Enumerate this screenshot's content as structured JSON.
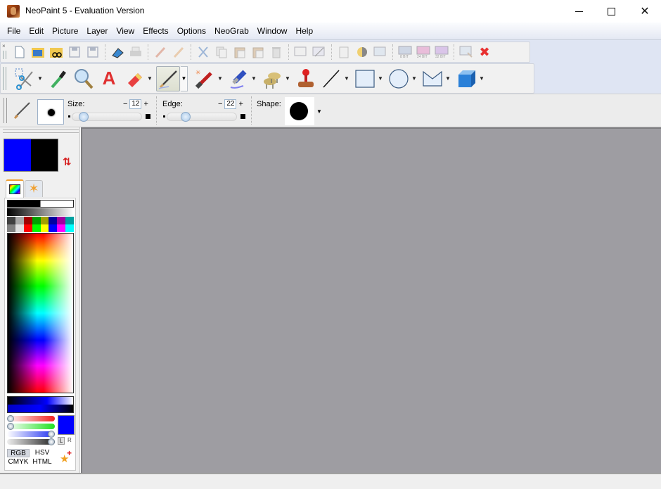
{
  "window": {
    "title": "NeoPaint 5 - Evaluation Version",
    "minimize": "minimize",
    "maximize": "maximize",
    "close": "✕"
  },
  "menu": [
    "File",
    "Edit",
    "Picture",
    "Layer",
    "View",
    "Effects",
    "Options",
    "NeoGrab",
    "Window",
    "Help"
  ],
  "main_toolbar": {
    "icons": [
      "new-icon",
      "open-icon",
      "browse-icon",
      "save-icon",
      "save-as-icon",
      "scan-icon",
      "print-icon",
      "undo-brush-icon",
      "redo-brush-icon",
      "cut-icon",
      "copy-icon",
      "paste-icon",
      "paste-special-icon",
      "delete-icon",
      "select-screen-icon",
      "capture-icon",
      "clipboard-icon",
      "contrast-icon",
      "resize-icon",
      "8bit-icon",
      "24bit-icon",
      "32bit-icon",
      "zoom-window-icon",
      "close-red-icon"
    ]
  },
  "tools_toolbar": {
    "tools": [
      "selection-scissors",
      "eyedropper",
      "magnifier",
      "text",
      "eraser",
      "brush",
      "paint-brush",
      "airbrush",
      "clone-sheep",
      "stamp",
      "line",
      "rectangle",
      "ellipse",
      "polygon",
      "3d-cube"
    ],
    "selected": "brush"
  },
  "options_bar": {
    "size_label": "Size:",
    "size_value": "12",
    "size_fraction": 0.1,
    "edge_label": "Edge:",
    "edge_value": "22",
    "edge_fraction": 0.22,
    "shape_label": "Shape:",
    "minus": "−",
    "plus": "+"
  },
  "colors": {
    "foreground": "#0000ff",
    "background": "#000000",
    "swatches": [
      "#404040",
      "#a8a8a8",
      "#a00000",
      "#00a000",
      "#a0a000",
      "#0000a0",
      "#a000a0",
      "#00a0a0",
      "#808080",
      "#e0e0e0",
      "#ff0000",
      "#00ff00",
      "#ffff00",
      "#0000ff",
      "#ff00ff",
      "#00ffff"
    ],
    "red_fraction": 0.0,
    "green_fraction": 0.0,
    "blue_fraction": 1.0,
    "alpha_fraction": 1.0,
    "lr_l": "L",
    "lr_r": "R",
    "modes": [
      "RGB",
      "HSV",
      "CMYK",
      "HTML"
    ],
    "active_mode": "RGB"
  }
}
